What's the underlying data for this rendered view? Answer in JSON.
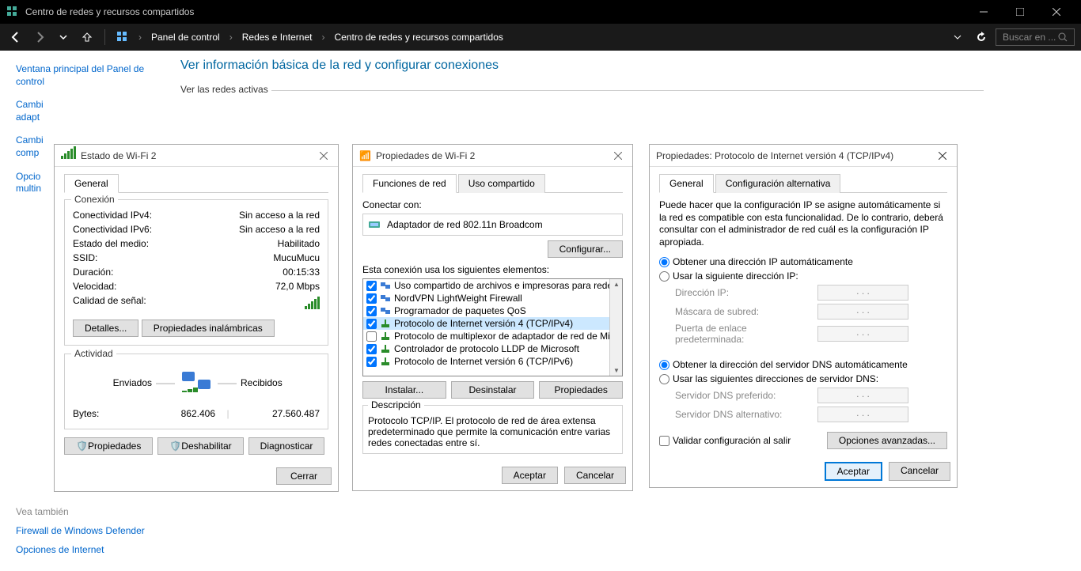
{
  "titlebar": {
    "title": "Centro de redes y recursos compartidos"
  },
  "navbar": {
    "crumbs": [
      "Panel de control",
      "Redes e Internet",
      "Centro de redes y recursos compartidos"
    ],
    "search_placeholder": "Buscar en ..."
  },
  "sidebar": {
    "main_link": "Ventana principal del Panel de control",
    "links": [
      "Cambiar configuración del adaptador",
      "Cambiar configuración de uso compartido avanzado",
      "Opciones de streaming multimedia"
    ]
  },
  "heading": "Ver información básica de la red y configurar conexiones",
  "active_heading": "Ver las redes activas",
  "see_also": {
    "heading": "Vea también",
    "links": [
      "Firewall de Windows Defender",
      "Opciones de Internet"
    ]
  },
  "dlg1": {
    "title": "Estado de Wi-Fi 2",
    "tabs": {
      "general": "General"
    },
    "conn_legend": "Conexión",
    "fields": {
      "ipv4_k": "Conectividad IPv4:",
      "ipv4_v": "Sin acceso a la red",
      "ipv6_k": "Conectividad IPv6:",
      "ipv6_v": "Sin acceso a la red",
      "media_k": "Estado del medio:",
      "media_v": "Habilitado",
      "ssid_k": "SSID:",
      "ssid_v": "MucuMucu",
      "dur_k": "Duración:",
      "dur_v": "00:15:33",
      "speed_k": "Velocidad:",
      "speed_v": "72,0 Mbps",
      "signal_k": "Calidad de señal:"
    },
    "btn_details": "Detalles...",
    "btn_wireless": "Propiedades inalámbricas",
    "activity_legend": "Actividad",
    "sent_label": "Enviados",
    "recv_label": "Recibidos",
    "bytes_label": "Bytes:",
    "bytes_sent": "862.406",
    "bytes_recv": "27.560.487",
    "btn_props": "Propiedades",
    "btn_disable": "Deshabilitar",
    "btn_diag": "Diagnosticar",
    "btn_close": "Cerrar"
  },
  "dlg2": {
    "title": "Propiedades de Wi-Fi 2",
    "tabs": {
      "net": "Funciones de red",
      "share": "Uso compartido"
    },
    "connect_label": "Conectar con:",
    "adapter": "Adaptador de red 802.11n Broadcom",
    "btn_config": "Configurar...",
    "uses_label": "Esta conexión usa los siguientes elementos:",
    "items": [
      {
        "checked": true,
        "label": "Uso compartido de archivos e impresoras para redes M",
        "icon": "client"
      },
      {
        "checked": true,
        "label": "NordVPN LightWeight Firewall",
        "icon": "client"
      },
      {
        "checked": true,
        "label": "Programador de paquetes QoS",
        "icon": "client"
      },
      {
        "checked": true,
        "label": "Protocolo de Internet versión 4 (TCP/IPv4)",
        "icon": "proto",
        "selected": true
      },
      {
        "checked": false,
        "label": "Protocolo de multiplexor de adaptador de red de Micros",
        "icon": "proto"
      },
      {
        "checked": true,
        "label": "Controlador de protocolo LLDP de Microsoft",
        "icon": "proto"
      },
      {
        "checked": true,
        "label": "Protocolo de Internet versión 6 (TCP/IPv6)",
        "icon": "proto"
      }
    ],
    "btn_install": "Instalar...",
    "btn_uninstall": "Desinstalar",
    "btn_props": "Propiedades",
    "desc_legend": "Descripción",
    "desc_text": "Protocolo TCP/IP. El protocolo de red de área extensa predeterminado que permite la comunicación entre varias redes conectadas entre sí.",
    "btn_accept": "Aceptar",
    "btn_cancel": "Cancelar"
  },
  "dlg3": {
    "title": "Propiedades: Protocolo de Internet versión 4 (TCP/IPv4)",
    "tabs": {
      "general": "General",
      "alt": "Configuración alternativa"
    },
    "intro": "Puede hacer que la configuración IP se asigne automáticamente si la red es compatible con esta funcionalidad. De lo contrario, deberá consultar con el administrador de red cuál es la configuración IP apropiada.",
    "opt_auto_ip": "Obtener una dirección IP automáticamente",
    "opt_manual_ip": "Usar la siguiente dirección IP:",
    "ip_lbl": "Dirección IP:",
    "mask_lbl": "Máscara de subred:",
    "gw_lbl": "Puerta de enlace predeterminada:",
    "opt_auto_dns": "Obtener la dirección del servidor DNS automáticamente",
    "opt_manual_dns": "Usar las siguientes direcciones de servidor DNS:",
    "dns1_lbl": "Servidor DNS preferido:",
    "dns2_lbl": "Servidor DNS alternativo:",
    "ip_empty": ".       .       .",
    "validate": "Validar configuración al salir",
    "btn_adv": "Opciones avanzadas...",
    "btn_accept": "Aceptar",
    "btn_cancel": "Cancelar"
  }
}
